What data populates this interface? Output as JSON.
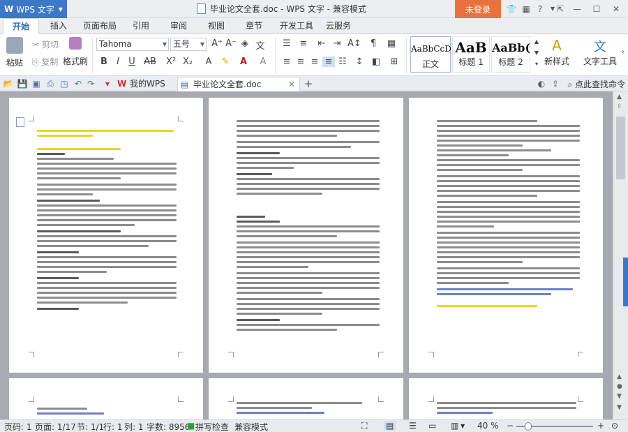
{
  "app": {
    "logo": "W",
    "name": "WPS 文字"
  },
  "window": {
    "title": "毕业论文全套.doc - WPS 文字 - 兼容模式",
    "login": "未登录"
  },
  "titlebar_icons": [
    "shirt-icon",
    "toolbox-icon",
    "help-icon",
    "minimize-to-tray-icon",
    "minimize-icon",
    "maximize-icon",
    "close-icon"
  ],
  "ribbon_tabs": [
    "开始",
    "插入",
    "页面布局",
    "引用",
    "审阅",
    "视图",
    "章节",
    "开发工具",
    "云服务"
  ],
  "ribbon": {
    "paste": "粘贴",
    "cut": "剪切",
    "copy": "复制",
    "format_painter": "格式刷",
    "font_name": "Tahoma",
    "font_size": "五号",
    "styles": [
      {
        "sample": "AaBbCcD",
        "label": "正文"
      },
      {
        "sample": "AaB",
        "label": "标题 1"
      },
      {
        "sample": "AaBb(",
        "label": "标题 2"
      }
    ],
    "new_style": "新样式",
    "text_tools": "文字工具"
  },
  "doc_tabs": [
    {
      "label": "我的WPS"
    },
    {
      "label": "毕业论文全套.doc"
    }
  ],
  "find_command": "点此查找命令",
  "status": {
    "page": "页码: 1",
    "page_of": "页面: 1/17",
    "section": "节: 1/1",
    "row": "行: 1",
    "col": "列: 1",
    "wordcount": "字数: 8956",
    "spellcheck": "拼写检查",
    "mode": "兼容模式",
    "zoom": "40 %"
  }
}
